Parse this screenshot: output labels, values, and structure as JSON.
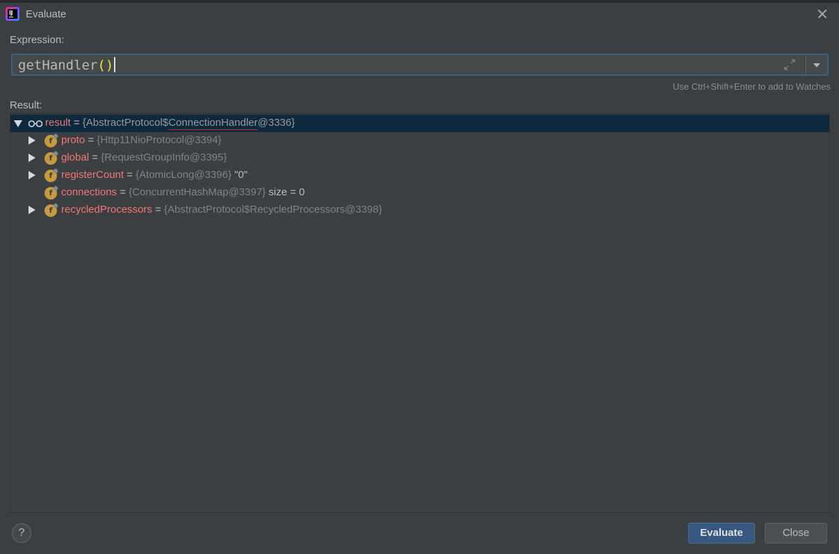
{
  "window": {
    "title": "Evaluate"
  },
  "expression": {
    "label": "Expression:",
    "value_name": "getHandler",
    "value_parens": "()",
    "hint": "Use Ctrl+Shift+Enter to add to Watches"
  },
  "result": {
    "label": "Result:",
    "root": {
      "name": "result",
      "type_prefix": "{AbstractProtocol$",
      "type_highlight": "ConnectionHandler",
      "type_suffix": "@3336}"
    },
    "fields": [
      {
        "name": "proto",
        "type": "{Http11NioProtocol@3394}",
        "value": "",
        "expandable": true
      },
      {
        "name": "global",
        "type": "{RequestGroupInfo@3395}",
        "value": "",
        "expandable": true
      },
      {
        "name": "registerCount",
        "type": "{AtomicLong@3396}",
        "value": "\"0\"",
        "expandable": true
      },
      {
        "name": "connections",
        "type": "{ConcurrentHashMap@3397}",
        "value": "size = 0",
        "expandable": false
      },
      {
        "name": "recycledProcessors",
        "type": "{AbstractProtocol$RecycledProcessors@3398}",
        "value": "",
        "expandable": true
      }
    ],
    "field_icon_letter": "f",
    "equals": "="
  },
  "buttons": {
    "help": "?",
    "evaluate": "Evaluate",
    "close": "Close"
  },
  "icons": {
    "app": "intellij-icon",
    "close": "close-icon",
    "expand": "expand-icon",
    "history": "chevron-down-icon",
    "watch": "glasses-icon",
    "field": "field-icon"
  },
  "colors": {
    "background": "#3c3f41",
    "selection": "#0d293e",
    "field_name": "#f07774",
    "accent": "#365880"
  }
}
